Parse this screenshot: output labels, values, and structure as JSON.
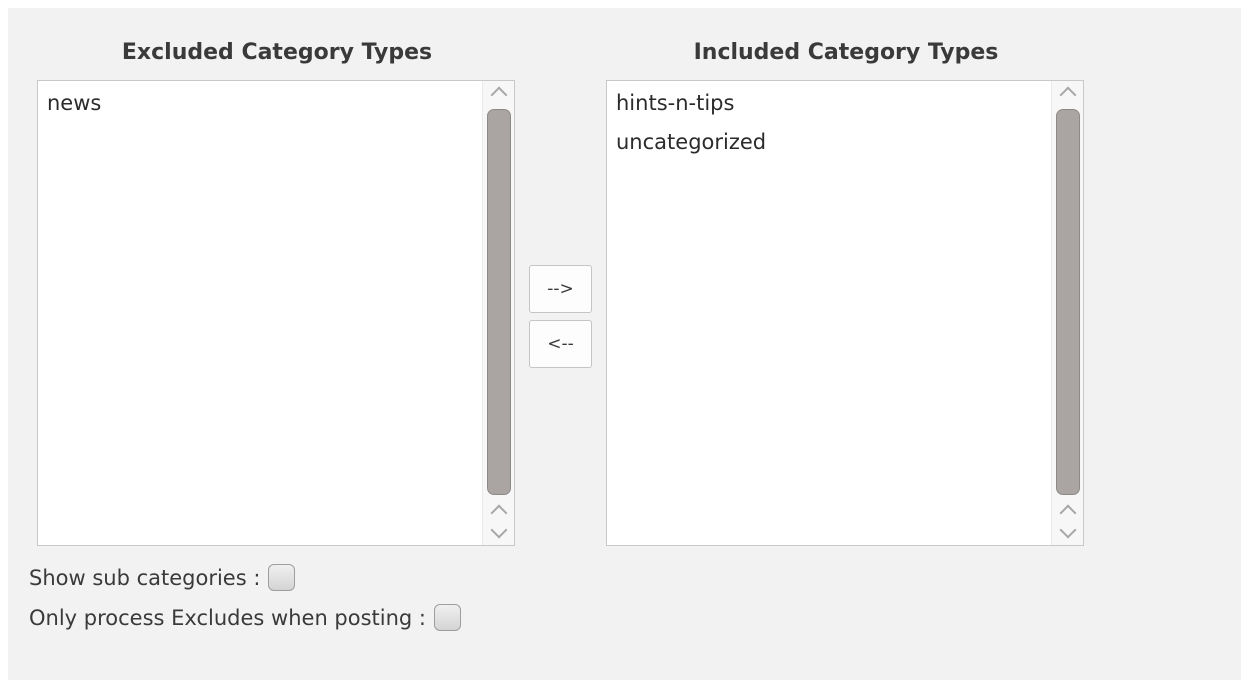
{
  "excluded": {
    "heading": "Excluded Category Types",
    "items": [
      "news"
    ]
  },
  "included": {
    "heading": "Included Category Types",
    "items": [
      "hints-n-tips",
      "uncategorized"
    ]
  },
  "buttons": {
    "move_right_label": "-->",
    "move_left_label": "<--"
  },
  "options": {
    "show_sub_categories": {
      "label": "Show sub categories :",
      "checked": false
    },
    "only_process_excludes": {
      "label": "Only process Excludes when posting :",
      "checked": false
    }
  },
  "icons": {
    "scroll_up": "chevron-up-icon",
    "scroll_down": "chevron-down-icon"
  },
  "colors": {
    "panel_background": "#f2f2f2",
    "scroll_thumb": "#aaa5a2"
  }
}
